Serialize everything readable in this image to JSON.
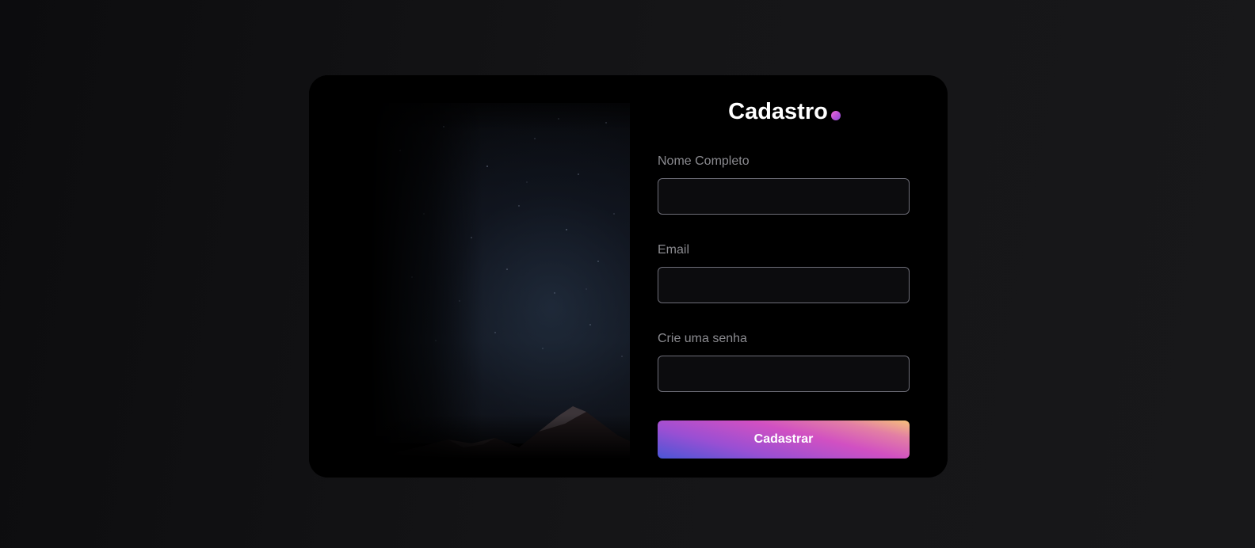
{
  "form": {
    "title": "Cadastro",
    "fields": [
      {
        "label": "Nome Completo",
        "value": "",
        "placeholder": ""
      },
      {
        "label": "Email",
        "value": "",
        "placeholder": ""
      },
      {
        "label": "Crie uma senha",
        "value": "",
        "placeholder": ""
      }
    ],
    "submit_label": "Cadastrar"
  },
  "colors": {
    "background": "#131315",
    "card": "#000000",
    "label": "#8b8b90",
    "input_border": "#6e6e78",
    "accent_gradient": [
      "#4a56d6",
      "#9a4fd3",
      "#d150c2",
      "#e37fa4",
      "#f5c07a"
    ]
  },
  "icons": {
    "title_dot": "gradient-dot-icon"
  }
}
